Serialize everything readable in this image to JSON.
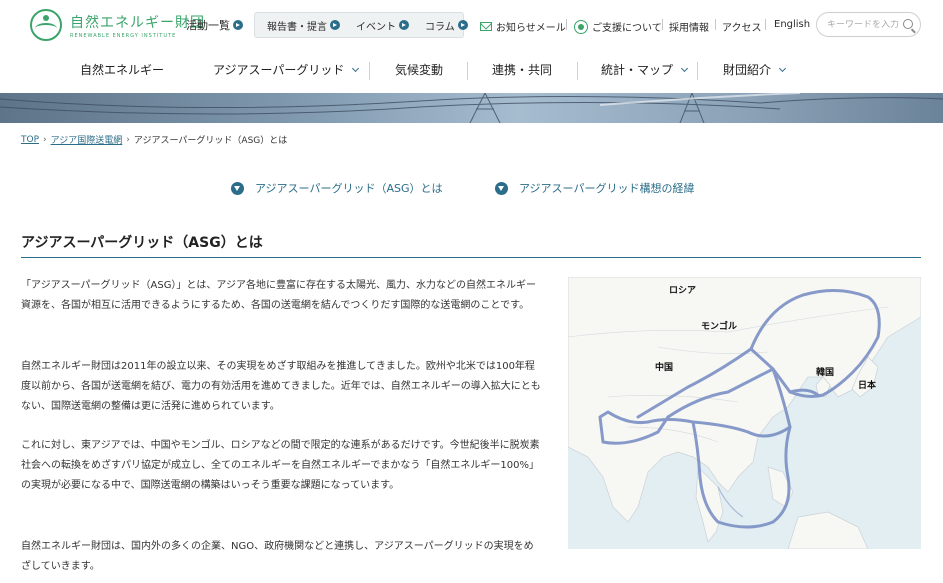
{
  "header": {
    "logo_ja": "自然エネルギー財団",
    "logo_en": "RENEWABLE ENERGY INSTITUTE",
    "activities_label": "活動一覧",
    "pill_items": [
      "報告書・提言",
      "イベント",
      "コラム"
    ],
    "newsletter_label": "お知らせメール",
    "support_label": "ご支援について",
    "careers_label": "採用情報",
    "access_label": "アクセス",
    "english_label": "English",
    "search_placeholder": "キーワードを入力"
  },
  "main_nav": [
    {
      "label": "自然エネルギー",
      "dropdown": false
    },
    {
      "label": "アジアスーパーグリッド",
      "dropdown": true
    },
    {
      "label": "気候変動",
      "dropdown": false
    },
    {
      "label": "連携・共同",
      "dropdown": false
    },
    {
      "label": "統計・マップ",
      "dropdown": true
    },
    {
      "label": "財団紹介",
      "dropdown": true
    }
  ],
  "breadcrumb": {
    "top": "TOP",
    "parent": "アジア国際送電網",
    "current": "アジアスーパーグリッド（ASG）とは"
  },
  "anchors": [
    "アジアスーパーグリッド（ASG）とは",
    "アジアスーパーグリッド構想の経緯"
  ],
  "section": {
    "title": "アジアスーパーグリッド（ASG）とは",
    "paragraphs": [
      "「アジアスーパーグリッド（ASG）」とは、アジア各地に豊富に存在する太陽光、風力、水力などの自然エネルギー資源を、各国が相互に活用できるようにするため、各国の送電網を結んでつくりだす国際的な送電網のことです。",
      "自然エネルギー財団は2011年の設立以来、その実現をめざす取組みを推進してきました。欧州や北米では100年程度以前から、各国が送電網を結び、電力の有効活用を進めてきました。近年では、自然エネルギーの導入拡大にともない、国際送電網の整備は更に活発に進められています。",
      "これに対し、東アジアでは、中国やモンゴル、ロシアなどの間で限定的な連系があるだけです。今世紀後半に脱炭素社会への転換をめざすパリ協定が成立し、全てのエネルギーを自然エネルギーでまかなう「自然エネルギー100%」の実現が必要になる中で、国際送電網の構築はいっそう重要な課題になっています。",
      "自然エネルギー財団は、国内外の多くの企業、NGO、政府機関などと連携し、アジアスーパーグリッドの実現をめざしていきます。"
    ]
  },
  "map": {
    "labels": {
      "russia": "ロシア",
      "mongolia": "モンゴル",
      "china": "中国",
      "korea": "韓国",
      "japan": "日本"
    },
    "grid_line_color": "#7a8fc4",
    "land_color": "#f7f7f4",
    "sea_color": "#e3eef3"
  },
  "colors": {
    "accent": "#2c6e8a",
    "brand_green": "#3aa46a"
  }
}
